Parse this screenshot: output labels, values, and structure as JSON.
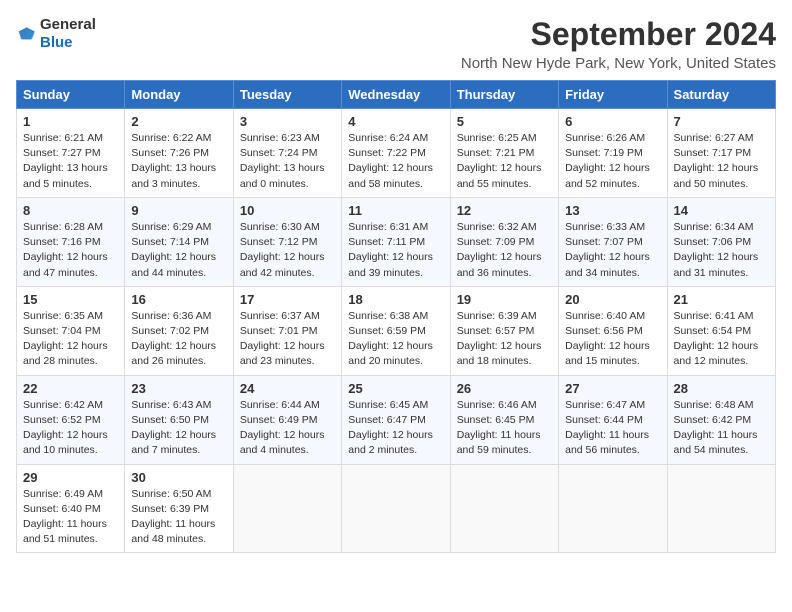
{
  "logo": {
    "text_general": "General",
    "text_blue": "Blue"
  },
  "title": "September 2024",
  "location": "North New Hyde Park, New York, United States",
  "headers": [
    "Sunday",
    "Monday",
    "Tuesday",
    "Wednesday",
    "Thursday",
    "Friday",
    "Saturday"
  ],
  "weeks": [
    [
      {
        "day": "1",
        "lines": [
          "Sunrise: 6:21 AM",
          "Sunset: 7:27 PM",
          "Daylight: 13 hours",
          "and 5 minutes."
        ]
      },
      {
        "day": "2",
        "lines": [
          "Sunrise: 6:22 AM",
          "Sunset: 7:26 PM",
          "Daylight: 13 hours",
          "and 3 minutes."
        ]
      },
      {
        "day": "3",
        "lines": [
          "Sunrise: 6:23 AM",
          "Sunset: 7:24 PM",
          "Daylight: 13 hours",
          "and 0 minutes."
        ]
      },
      {
        "day": "4",
        "lines": [
          "Sunrise: 6:24 AM",
          "Sunset: 7:22 PM",
          "Daylight: 12 hours",
          "and 58 minutes."
        ]
      },
      {
        "day": "5",
        "lines": [
          "Sunrise: 6:25 AM",
          "Sunset: 7:21 PM",
          "Daylight: 12 hours",
          "and 55 minutes."
        ]
      },
      {
        "day": "6",
        "lines": [
          "Sunrise: 6:26 AM",
          "Sunset: 7:19 PM",
          "Daylight: 12 hours",
          "and 52 minutes."
        ]
      },
      {
        "day": "7",
        "lines": [
          "Sunrise: 6:27 AM",
          "Sunset: 7:17 PM",
          "Daylight: 12 hours",
          "and 50 minutes."
        ]
      }
    ],
    [
      {
        "day": "8",
        "lines": [
          "Sunrise: 6:28 AM",
          "Sunset: 7:16 PM",
          "Daylight: 12 hours",
          "and 47 minutes."
        ]
      },
      {
        "day": "9",
        "lines": [
          "Sunrise: 6:29 AM",
          "Sunset: 7:14 PM",
          "Daylight: 12 hours",
          "and 44 minutes."
        ]
      },
      {
        "day": "10",
        "lines": [
          "Sunrise: 6:30 AM",
          "Sunset: 7:12 PM",
          "Daylight: 12 hours",
          "and 42 minutes."
        ]
      },
      {
        "day": "11",
        "lines": [
          "Sunrise: 6:31 AM",
          "Sunset: 7:11 PM",
          "Daylight: 12 hours",
          "and 39 minutes."
        ]
      },
      {
        "day": "12",
        "lines": [
          "Sunrise: 6:32 AM",
          "Sunset: 7:09 PM",
          "Daylight: 12 hours",
          "and 36 minutes."
        ]
      },
      {
        "day": "13",
        "lines": [
          "Sunrise: 6:33 AM",
          "Sunset: 7:07 PM",
          "Daylight: 12 hours",
          "and 34 minutes."
        ]
      },
      {
        "day": "14",
        "lines": [
          "Sunrise: 6:34 AM",
          "Sunset: 7:06 PM",
          "Daylight: 12 hours",
          "and 31 minutes."
        ]
      }
    ],
    [
      {
        "day": "15",
        "lines": [
          "Sunrise: 6:35 AM",
          "Sunset: 7:04 PM",
          "Daylight: 12 hours",
          "and 28 minutes."
        ]
      },
      {
        "day": "16",
        "lines": [
          "Sunrise: 6:36 AM",
          "Sunset: 7:02 PM",
          "Daylight: 12 hours",
          "and 26 minutes."
        ]
      },
      {
        "day": "17",
        "lines": [
          "Sunrise: 6:37 AM",
          "Sunset: 7:01 PM",
          "Daylight: 12 hours",
          "and 23 minutes."
        ]
      },
      {
        "day": "18",
        "lines": [
          "Sunrise: 6:38 AM",
          "Sunset: 6:59 PM",
          "Daylight: 12 hours",
          "and 20 minutes."
        ]
      },
      {
        "day": "19",
        "lines": [
          "Sunrise: 6:39 AM",
          "Sunset: 6:57 PM",
          "Daylight: 12 hours",
          "and 18 minutes."
        ]
      },
      {
        "day": "20",
        "lines": [
          "Sunrise: 6:40 AM",
          "Sunset: 6:56 PM",
          "Daylight: 12 hours",
          "and 15 minutes."
        ]
      },
      {
        "day": "21",
        "lines": [
          "Sunrise: 6:41 AM",
          "Sunset: 6:54 PM",
          "Daylight: 12 hours",
          "and 12 minutes."
        ]
      }
    ],
    [
      {
        "day": "22",
        "lines": [
          "Sunrise: 6:42 AM",
          "Sunset: 6:52 PM",
          "Daylight: 12 hours",
          "and 10 minutes."
        ]
      },
      {
        "day": "23",
        "lines": [
          "Sunrise: 6:43 AM",
          "Sunset: 6:50 PM",
          "Daylight: 12 hours",
          "and 7 minutes."
        ]
      },
      {
        "day": "24",
        "lines": [
          "Sunrise: 6:44 AM",
          "Sunset: 6:49 PM",
          "Daylight: 12 hours",
          "and 4 minutes."
        ]
      },
      {
        "day": "25",
        "lines": [
          "Sunrise: 6:45 AM",
          "Sunset: 6:47 PM",
          "Daylight: 12 hours",
          "and 2 minutes."
        ]
      },
      {
        "day": "26",
        "lines": [
          "Sunrise: 6:46 AM",
          "Sunset: 6:45 PM",
          "Daylight: 11 hours",
          "and 59 minutes."
        ]
      },
      {
        "day": "27",
        "lines": [
          "Sunrise: 6:47 AM",
          "Sunset: 6:44 PM",
          "Daylight: 11 hours",
          "and 56 minutes."
        ]
      },
      {
        "day": "28",
        "lines": [
          "Sunrise: 6:48 AM",
          "Sunset: 6:42 PM",
          "Daylight: 11 hours",
          "and 54 minutes."
        ]
      }
    ],
    [
      {
        "day": "29",
        "lines": [
          "Sunrise: 6:49 AM",
          "Sunset: 6:40 PM",
          "Daylight: 11 hours",
          "and 51 minutes."
        ]
      },
      {
        "day": "30",
        "lines": [
          "Sunrise: 6:50 AM",
          "Sunset: 6:39 PM",
          "Daylight: 11 hours",
          "and 48 minutes."
        ]
      },
      {
        "day": "",
        "lines": []
      },
      {
        "day": "",
        "lines": []
      },
      {
        "day": "",
        "lines": []
      },
      {
        "day": "",
        "lines": []
      },
      {
        "day": "",
        "lines": []
      }
    ]
  ]
}
